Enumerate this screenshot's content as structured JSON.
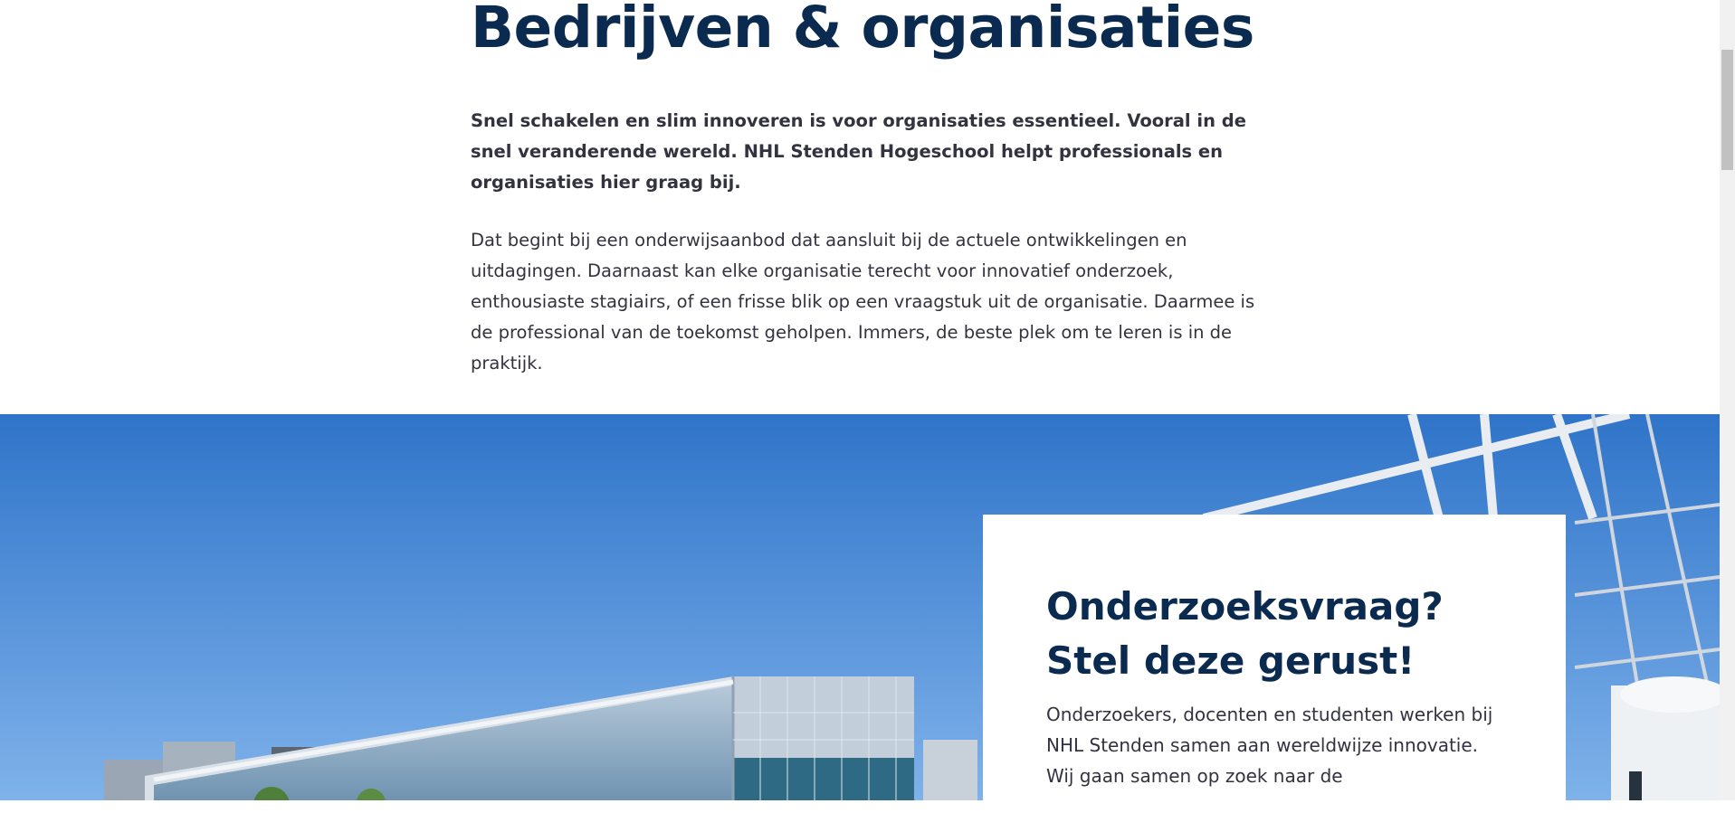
{
  "title": "Bedrijven & organisaties",
  "intro": "Snel schakelen en slim innoveren is voor organisaties essentieel. Vooral in de snel veranderende wereld. NHL Stenden Hogeschool helpt professionals en organisaties hier graag bij.",
  "body": "Dat begint bij een onderwijsaanbod dat aansluit bij de actuele ontwikkelingen en uitdagingen. Daarnaast kan elke organisatie terecht voor innovatief onderzoek, enthousiaste stagiairs, of een frisse blik op een vraagstuk uit de organisatie. Daarmee is de professional van de toekomst geholpen. Immers, de beste plek om te leren is in de praktijk.",
  "card": {
    "title": "Onderzoeksvraag? Stel deze gerust!",
    "text": "Onderzoekers, docenten en studenten werken bij NHL Stenden samen aan wereldwijze innovatie. Wij gaan samen op zoek naar de"
  },
  "colors": {
    "heading": "#0b2a4f",
    "text": "#333340",
    "sky": "#3b7fd0"
  }
}
